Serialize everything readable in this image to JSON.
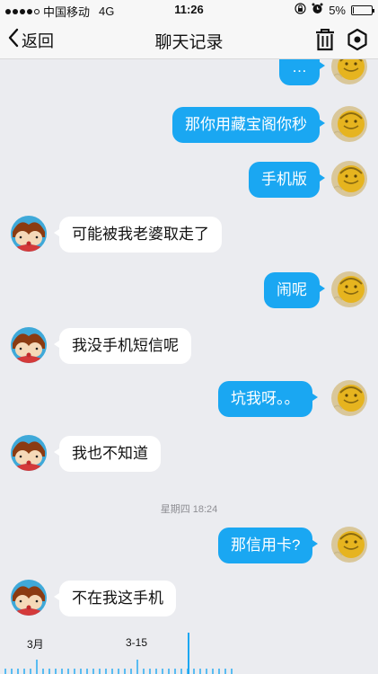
{
  "status_bar": {
    "carrier": "中国移动",
    "network": "4G",
    "time": "11:26",
    "battery": "5%",
    "battery_level": 0.05
  },
  "nav": {
    "back_label": "返回",
    "title": "聊天记录"
  },
  "messages": [
    {
      "dir": "out",
      "text": "…"
    },
    {
      "dir": "out",
      "text": "那你用藏宝阁你秒"
    },
    {
      "dir": "out",
      "text": "手机版"
    },
    {
      "dir": "in",
      "text": "可能被我老婆取走了"
    },
    {
      "dir": "out",
      "text": "闹呢"
    },
    {
      "dir": "in",
      "text": "我没手机短信呢"
    },
    {
      "dir": "out",
      "text": "坑我呀。。"
    },
    {
      "dir": "in",
      "text": "我也不知道"
    },
    {
      "dir": "out",
      "text": "那信用卡?"
    },
    {
      "dir": "in",
      "text": "不在我这手机"
    }
  ],
  "timestamp": "星期四 18:24",
  "timeline": {
    "labels": [
      "3月",
      "3-15"
    ]
  },
  "colors": {
    "outgoing_bubble": "#1aa7f2",
    "incoming_bubble": "#ffffff",
    "background": "#ebecf0"
  }
}
